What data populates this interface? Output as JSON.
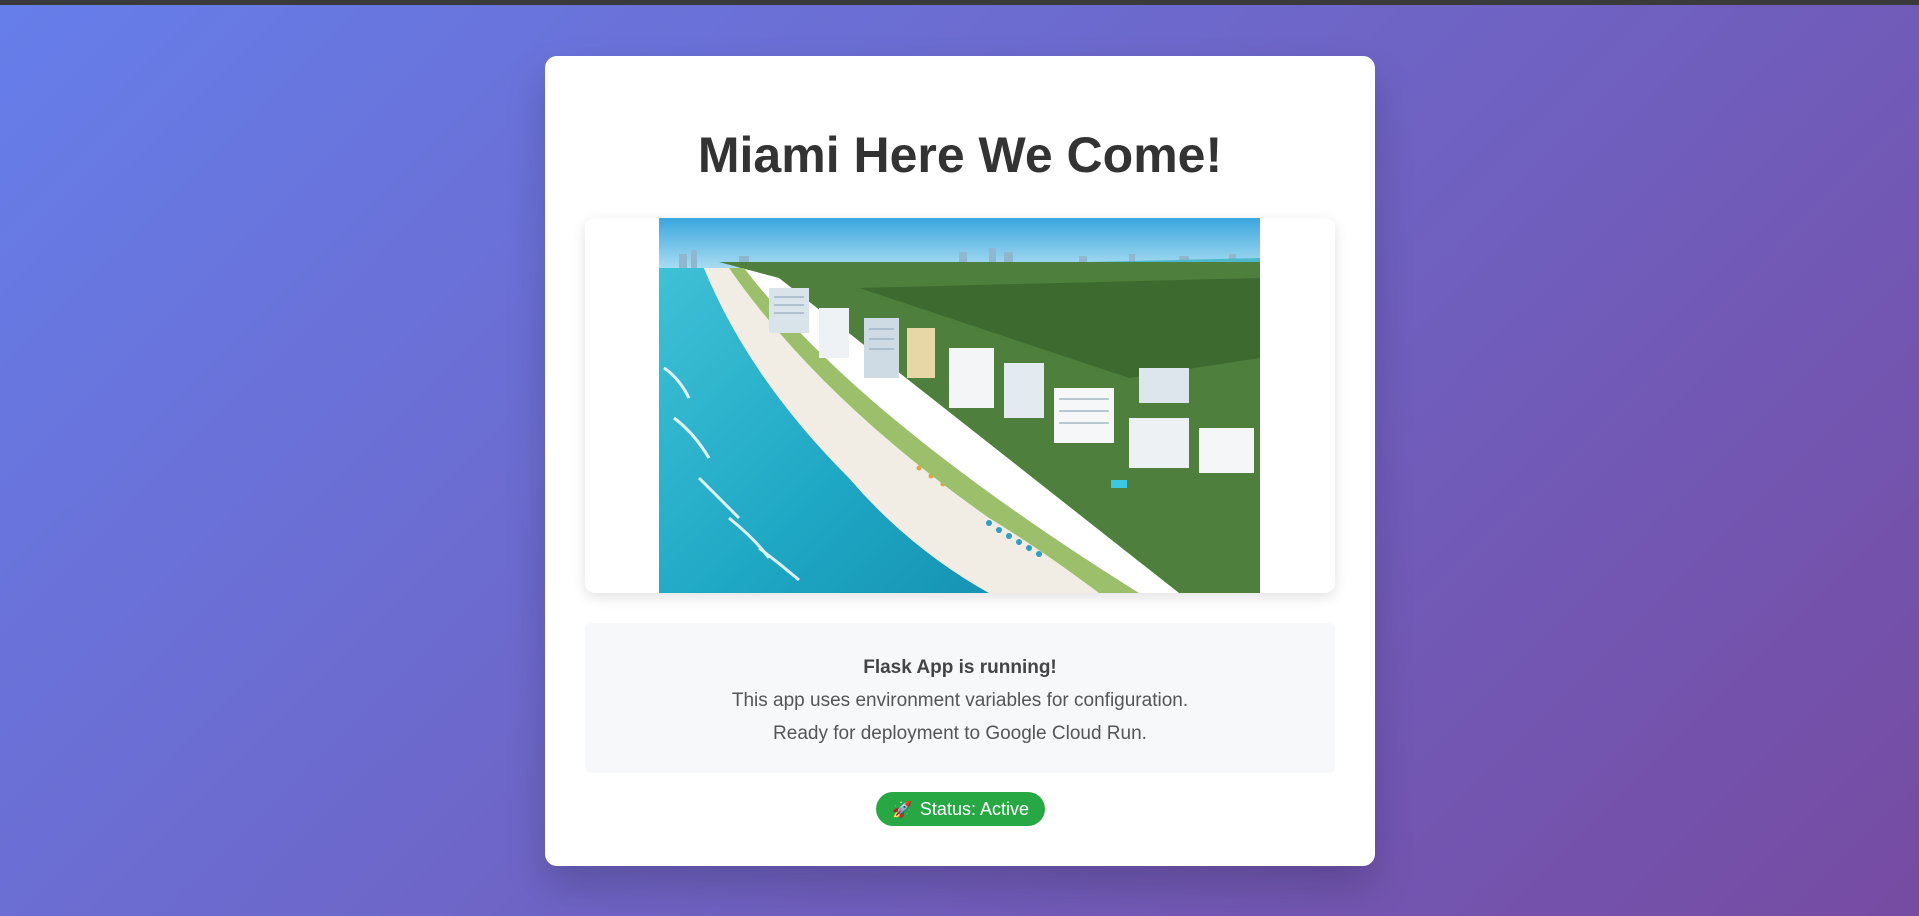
{
  "page": {
    "title": "Miami Here We Come!"
  },
  "info": {
    "heading": "Flask App is running!",
    "line1": "This app uses environment variables for configuration.",
    "line2": "Ready for deployment to Google Cloud Run."
  },
  "status": {
    "icon": "rocket-icon",
    "label": "Status: Active"
  },
  "colors": {
    "gradient_start": "#667eea",
    "gradient_end": "#764ba2",
    "status_green": "#28a745",
    "title_text": "#333333"
  }
}
